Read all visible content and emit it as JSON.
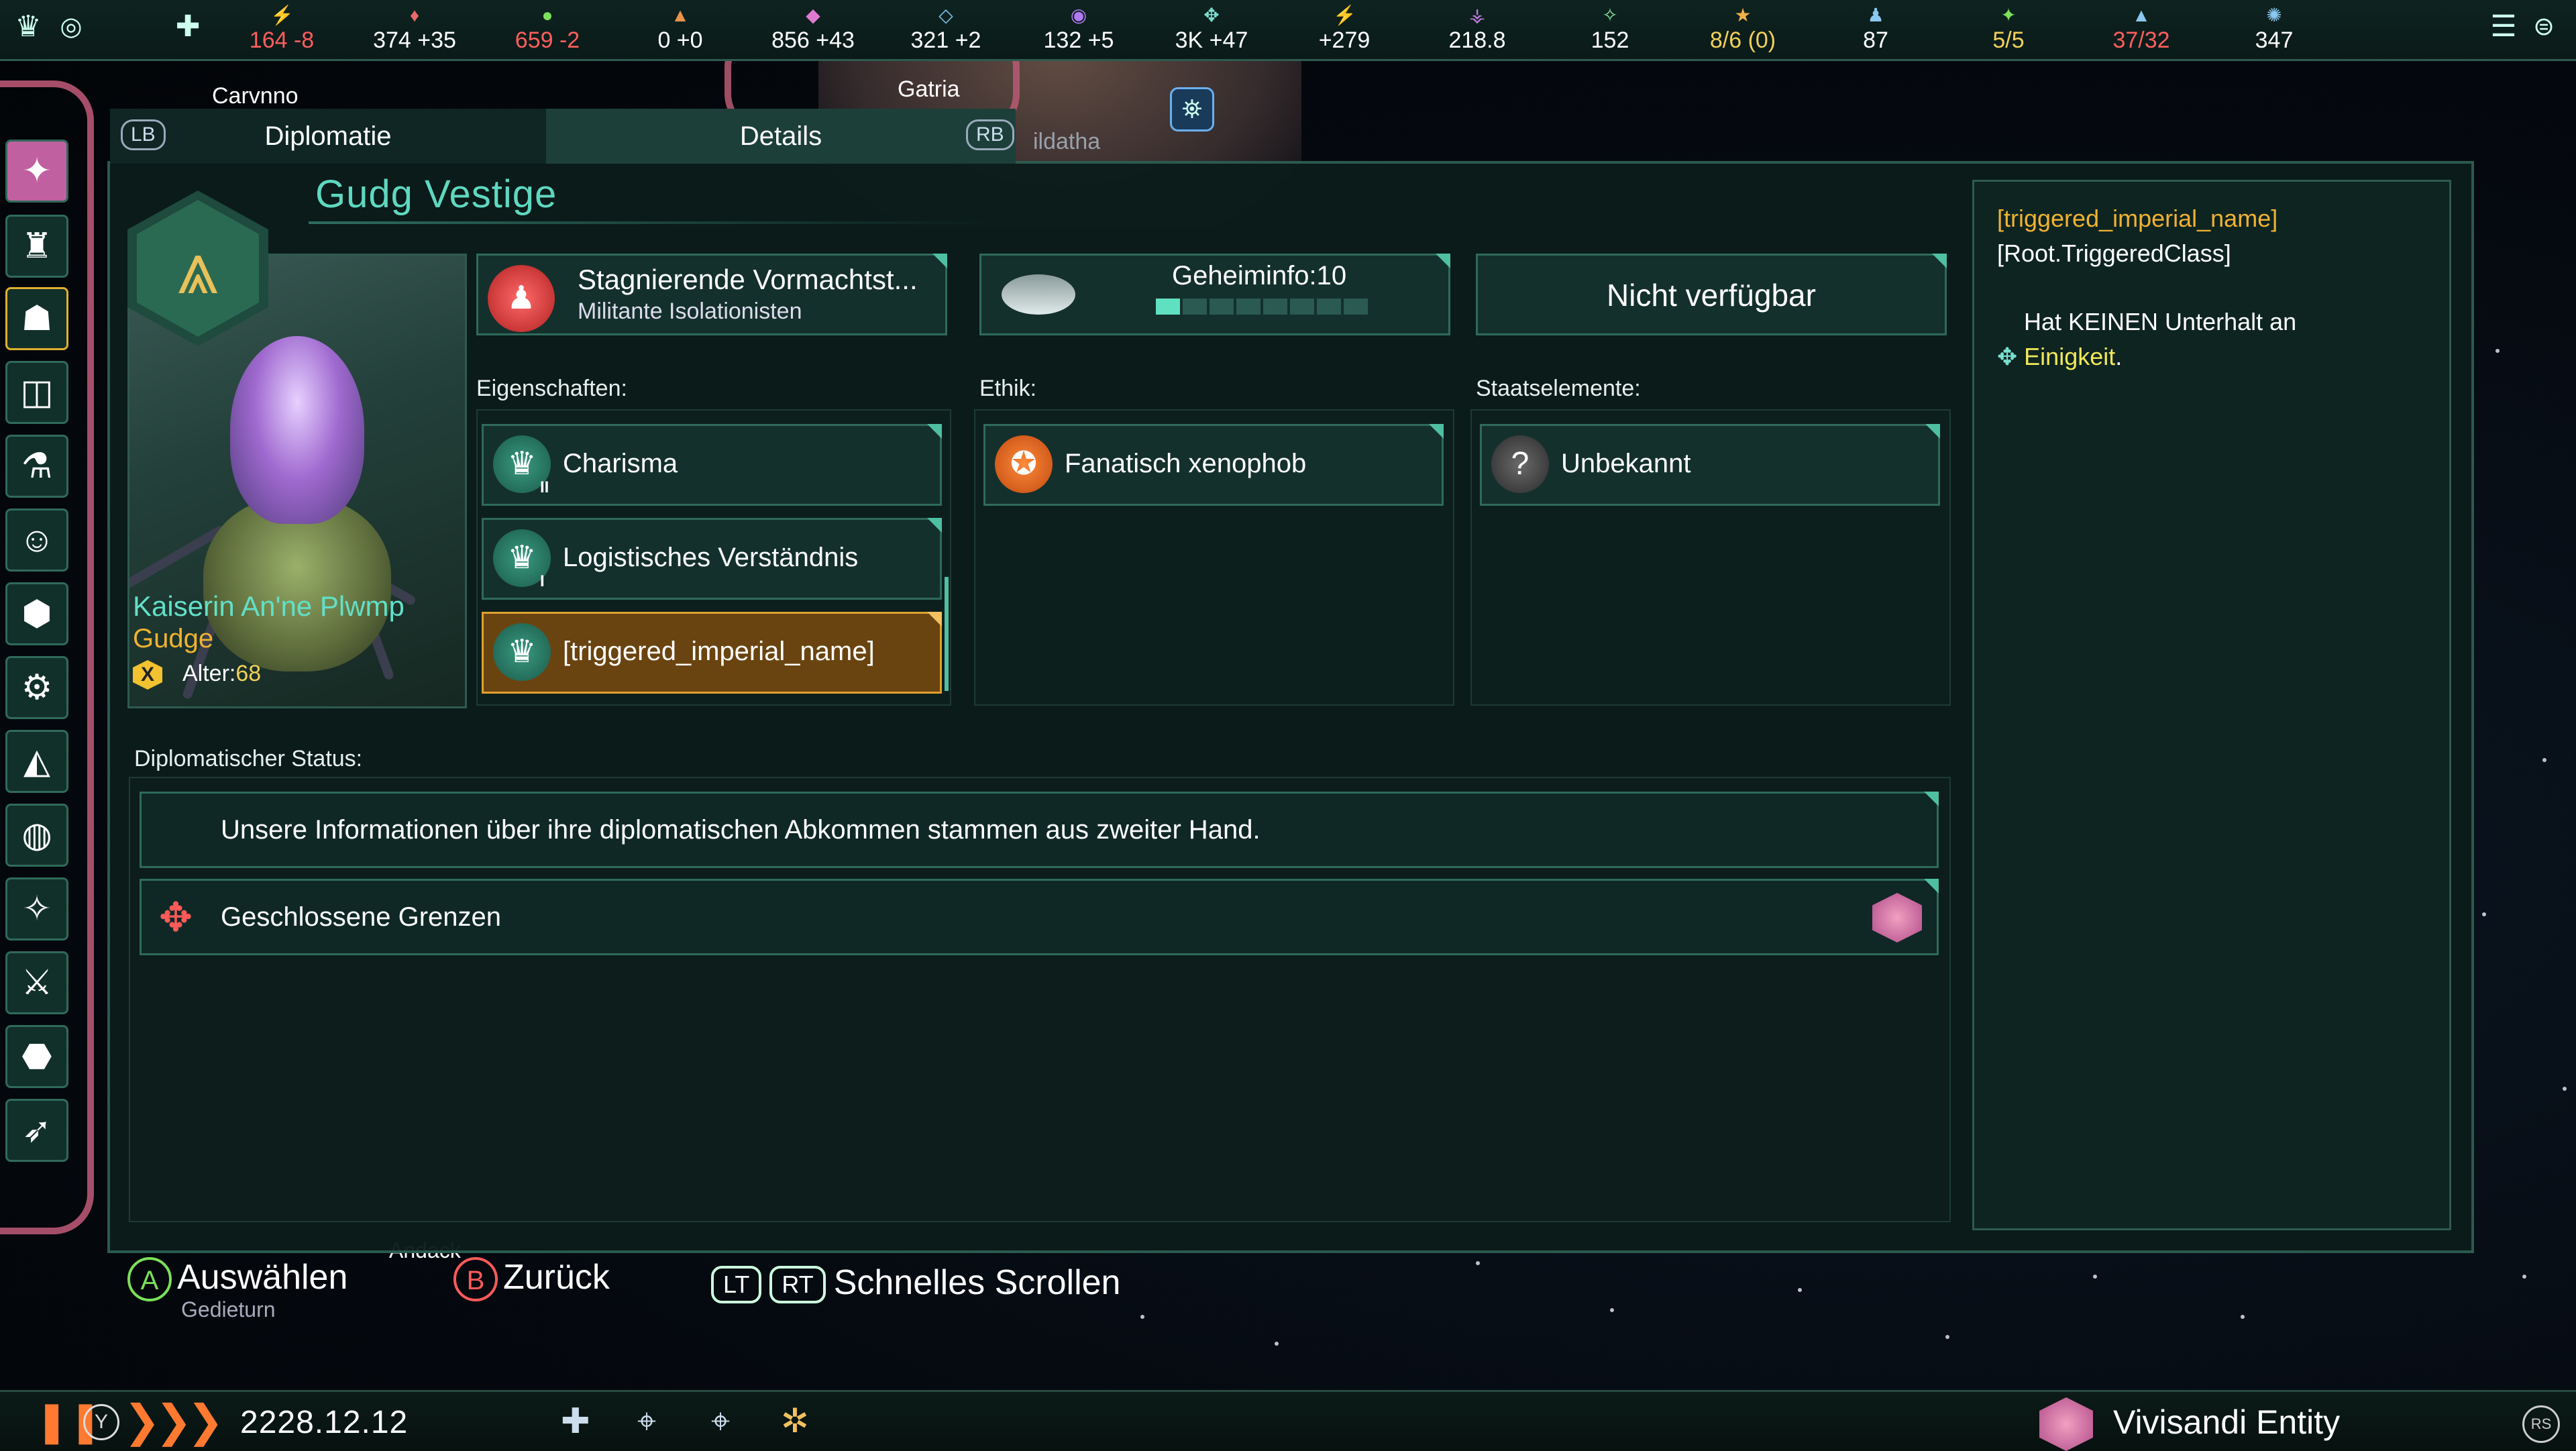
{
  "colors": {
    "accent": "#5fd8c0",
    "panel": "#14302c",
    "border": "#2f6a5a",
    "negative": "#ff5e5e",
    "warning": "#f2d05a",
    "gold": "#f0b232"
  },
  "topbar": {
    "resources": [
      {
        "icon": "energy-icon",
        "value": "164 -8",
        "tone": "red",
        "color": "#f2d05a"
      },
      {
        "icon": "minerals-icon",
        "value": "374 +35",
        "tone": "",
        "color": "#e86a6a"
      },
      {
        "icon": "food-icon",
        "value": "659 -2",
        "tone": "red",
        "color": "#7be05a"
      },
      {
        "icon": "consumer-goods-icon",
        "value": "0 +0",
        "tone": "",
        "color": "#e8944a"
      },
      {
        "icon": "alloys-icon",
        "value": "856 +43",
        "tone": "",
        "color": "#e07ad0"
      },
      {
        "icon": "influence-icon",
        "value": "321 +2",
        "tone": "",
        "color": "#7ac8f0"
      },
      {
        "icon": "unity-icon",
        "value": "132 +5",
        "tone": "",
        "color": "#b07af0"
      },
      {
        "icon": "amenities-icon",
        "value": "3K +47",
        "tone": "",
        "color": "#7ae0d0"
      },
      {
        "icon": "research-physics-icon",
        "value": "+279",
        "tone": "",
        "color": "#f2b04a"
      },
      {
        "icon": "research-society-icon",
        "value": "218.8",
        "tone": "",
        "color": "#c07ae0"
      },
      {
        "icon": "research-engineering-icon",
        "value": "152",
        "tone": "",
        "color": "#8ae0a0"
      },
      {
        "icon": "leaders-icon",
        "value": "8/6 (0)",
        "tone": "yellow",
        "color": "#f2b04a"
      },
      {
        "icon": "pops-icon",
        "value": "87",
        "tone": "",
        "color": "#8ac8f0"
      },
      {
        "icon": "envoys-icon",
        "value": "5/5",
        "tone": "yellow",
        "color": "#7be05a"
      },
      {
        "icon": "fleet-capacity-icon",
        "value": "37/32",
        "tone": "red",
        "color": "#8ac8f0"
      },
      {
        "icon": "starbase-capacity-icon",
        "value": "347",
        "tone": "",
        "color": "#8ac8f0"
      }
    ]
  },
  "map_labels": {
    "carvnno": "Carvnno",
    "gatria": "Gatria",
    "ildatha": "ildatha",
    "andack": "Andack",
    "gedieturn": "Gedieturn"
  },
  "tabs": {
    "lb": "LB",
    "diplomacy": "Diplomatie",
    "details": "Details",
    "rb": "RB"
  },
  "empire": {
    "name": "Gudg Vestige",
    "ruler_name": "Kaiserin An'ne Plwmp",
    "species": "Gudge",
    "age_label": "Alter:",
    "age_value": "68",
    "x_badge": "X"
  },
  "info_cards": {
    "government_title": "Stagnierende Vormachtst...",
    "government_sub": "Militante Isolationisten",
    "intel_label": "Geheiminfo:10",
    "intel_level": 1,
    "intel_segments": 8,
    "unavailable": "Nicht verfügbar"
  },
  "sections": {
    "traits_label": "Eigenschaften:",
    "ethics_label": "Ethik:",
    "civics_label": "Staatselemente:",
    "diplo_status_label": "Diplomatischer Status:"
  },
  "traits": [
    {
      "label": "Charisma",
      "icon": "charisma-trait-icon",
      "tier": "II"
    },
    {
      "label": "Logistisches Verständnis",
      "icon": "logistics-trait-icon",
      "tier": "I"
    },
    {
      "label": "[triggered_imperial_name]",
      "icon": "crown-icon",
      "tier": ""
    }
  ],
  "ethics": [
    {
      "label": "Fanatisch xenophob",
      "icon": "xenophobe-icon"
    }
  ],
  "civics": [
    {
      "label": "Unbekannt",
      "icon": "question-icon",
      "glyph": "?"
    }
  ],
  "diplo_status": {
    "secondhand": "Unsere Informationen über ihre diplomatischen Abkommen stammen aus zweiter Hand.",
    "closed_borders": "Geschlossene Grenzen"
  },
  "tooltip": {
    "title": "[triggered_imperial_name]",
    "class": "[Root.TriggeredClass]",
    "line1": "Hat KEINEN Unterhalt an",
    "line2": "Einigkeit",
    "period": "."
  },
  "controller_hints": {
    "a": "A",
    "select": "Auswählen",
    "b": "B",
    "back": "Zurück",
    "lt": "LT",
    "rt": "RT",
    "fast_scroll": "Schnelles Scrollen"
  },
  "bottombar": {
    "date": "2228.12.12",
    "y_button": "Y",
    "empire_name": "Vivisandi Entity"
  }
}
